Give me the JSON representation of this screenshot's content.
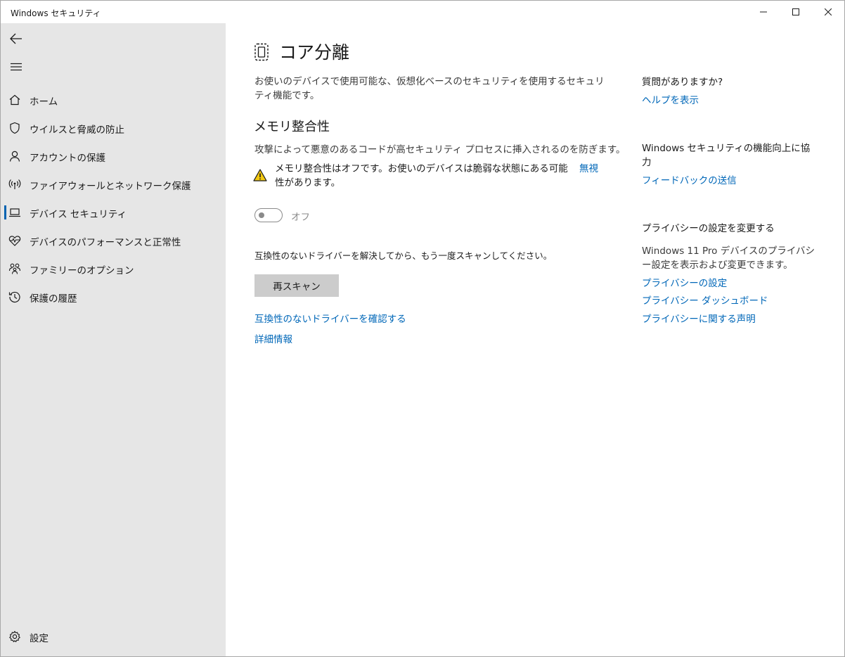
{
  "window": {
    "title": "Windows セキュリティ"
  },
  "sidebar": {
    "items": [
      {
        "label": "ホーム",
        "icon": "home-icon"
      },
      {
        "label": "ウイルスと脅威の防止",
        "icon": "shield-icon"
      },
      {
        "label": "アカウントの保護",
        "icon": "person-icon"
      },
      {
        "label": "ファイアウォールとネットワーク保護",
        "icon": "antenna-icon"
      },
      {
        "label": "デバイス セキュリティ",
        "icon": "laptop-icon",
        "active": true
      },
      {
        "label": "デバイスのパフォーマンスと正常性",
        "icon": "heart-pulse-icon"
      },
      {
        "label": "ファミリーのオプション",
        "icon": "family-icon"
      },
      {
        "label": "保護の履歴",
        "icon": "history-icon"
      }
    ],
    "settings_label": "設定"
  },
  "main": {
    "title": "コア分離",
    "description": "お使いのデバイスで使用可能な、仮想化ベースのセキュリティを使用するセキュリティ機能です。",
    "memory_integrity": {
      "heading": "メモリ整合性",
      "description": "攻撃によって悪意のあるコードが高セキュリティ プロセスに挿入されるのを防ぎます。",
      "warning": "メモリ整合性はオフです。お使いのデバイスは脆弱な状態にある可能性があります。",
      "ignore_link": "無視",
      "toggle_state": "オフ",
      "toggle_on": false
    },
    "instruction": "互換性のないドライバーを解決してから、もう一度スキャンしてください。",
    "rescan_button": "再スキャン",
    "links": {
      "incompatible_drivers": "互換性のないドライバーを確認する",
      "details": "詳細情報"
    }
  },
  "aside": {
    "question_heading": "質問がありますか?",
    "help_link": "ヘルプを表示",
    "improve_heading": "Windows セキュリティの機能向上に協力",
    "feedback_link": "フィードバックの送信",
    "privacy_heading": "プライバシーの設定を変更する",
    "privacy_text": "Windows 11 Pro デバイスのプライバシー設定を表示および変更できます。",
    "privacy_links": [
      "プライバシーの設定",
      "プライバシー ダッシュボード",
      "プライバシーに関する声明"
    ]
  },
  "colors": {
    "accent": "#0067b8",
    "sidebar_bg": "#e6e6e6",
    "warning": "#f2c811"
  }
}
